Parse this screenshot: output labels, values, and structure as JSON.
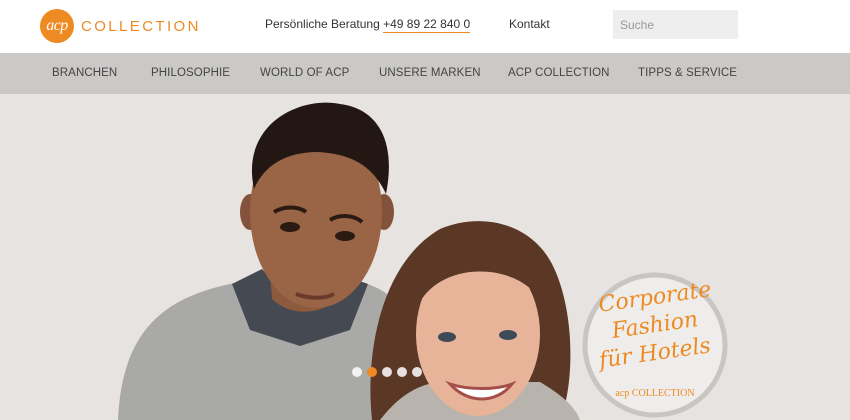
{
  "brand": {
    "logo_mark": "acp",
    "logo_word": "COLLECTION",
    "accent_color": "#ee8a22"
  },
  "header": {
    "consult_label": "Persönliche Beratung",
    "phone": "+49 89 22 840 0",
    "contact_label": "Kontakt",
    "search_placeholder": "Suche"
  },
  "nav": {
    "items": [
      {
        "label": "BRANCHEN"
      },
      {
        "label": "PHILOSOPHIE"
      },
      {
        "label": "WORLD OF ACP"
      },
      {
        "label": "UNSERE MARKEN"
      },
      {
        "label": "ACP COLLECTION"
      },
      {
        "label": "TIPPS & SERVICE"
      }
    ]
  },
  "hero": {
    "badge": {
      "line1": "Corporate",
      "line2": "Fashion",
      "line3": "für Hotels",
      "sub": "acp COLLECTION"
    },
    "slider": {
      "total": 5,
      "active": 2
    }
  }
}
